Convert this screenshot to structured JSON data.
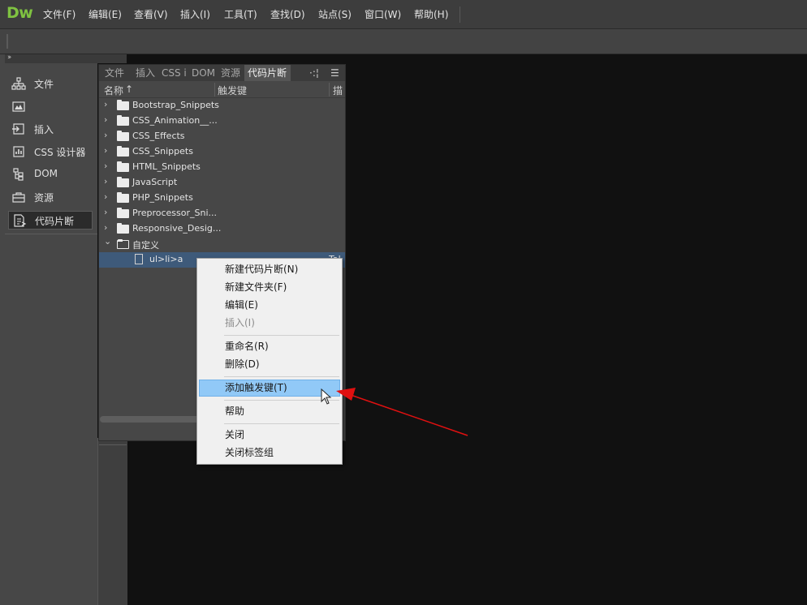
{
  "app": {
    "logo": "Dw"
  },
  "menubar": {
    "items": [
      "文件(F)",
      "编辑(E)",
      "查看(V)",
      "插入(I)",
      "工具(T)",
      "查找(D)",
      "站点(S)",
      "窗口(W)",
      "帮助(H)"
    ]
  },
  "sidebar": {
    "collapse_glyph": "››",
    "items": [
      {
        "label": "文件",
        "icon": "site-tree-icon"
      },
      {
        "label": "",
        "icon": "image-icon"
      },
      {
        "label": "插入",
        "icon": "insert-icon"
      },
      {
        "label": "CSS 设计器",
        "icon": "css-designer-icon"
      },
      {
        "label": "DOM",
        "icon": "dom-tree-icon"
      },
      {
        "label": "资源",
        "icon": "assets-icon"
      },
      {
        "label": "代码片断",
        "icon": "snippets-icon"
      }
    ]
  },
  "panel": {
    "tabs": [
      "文件",
      "插入",
      "CSS i",
      "DOM",
      "资源",
      "代码片断"
    ],
    "active_tab": "代码片断",
    "tab_options_glyph": "·:¦",
    "tab_menu_glyph": "☰",
    "columns": {
      "name": "名称",
      "sort_glyph": "↑",
      "trigger": "触发键",
      "desc": "描"
    },
    "folders": [
      {
        "name": "Bootstrap_Snippets",
        "chevron": "›"
      },
      {
        "name": "CSS_Animation__...",
        "chevron": "›"
      },
      {
        "name": "CSS_Effects",
        "chevron": "›"
      },
      {
        "name": "CSS_Snippets",
        "chevron": "›"
      },
      {
        "name": "HTML_Snippets",
        "chevron": "›"
      },
      {
        "name": "JavaScript",
        "chevron": "›"
      },
      {
        "name": "PHP_Snippets",
        "chevron": "›"
      },
      {
        "name": "Preprocessor_Sni...",
        "chevron": "›"
      },
      {
        "name": "Responsive_Desig...",
        "chevron": "›"
      },
      {
        "name": "自定义",
        "chevron": "⌄"
      }
    ],
    "selected_snippet": {
      "name": "ul>li>a",
      "trigger": "Tal"
    }
  },
  "context_menu": {
    "groups": [
      [
        {
          "label": "新建代码片断(N)",
          "disabled": false
        },
        {
          "label": "新建文件夹(F)",
          "disabled": false
        },
        {
          "label": "编辑(E)",
          "disabled": false
        },
        {
          "label": "插入(I)",
          "disabled": true
        }
      ],
      [
        {
          "label": "重命名(R)",
          "disabled": false
        },
        {
          "label": "删除(D)",
          "disabled": false
        }
      ],
      [
        {
          "label": "添加触发键(T)",
          "disabled": false,
          "highlighted": true
        }
      ],
      [
        {
          "label": "帮助",
          "disabled": false
        }
      ],
      [
        {
          "label": "关闭",
          "disabled": false
        },
        {
          "label": "关闭标签组",
          "disabled": false
        }
      ]
    ]
  },
  "colors": {
    "logo": "#7fc241",
    "highlight": "#91c9f7",
    "selection": "#3e5a7a",
    "annotation_arrow": "#e01010"
  }
}
